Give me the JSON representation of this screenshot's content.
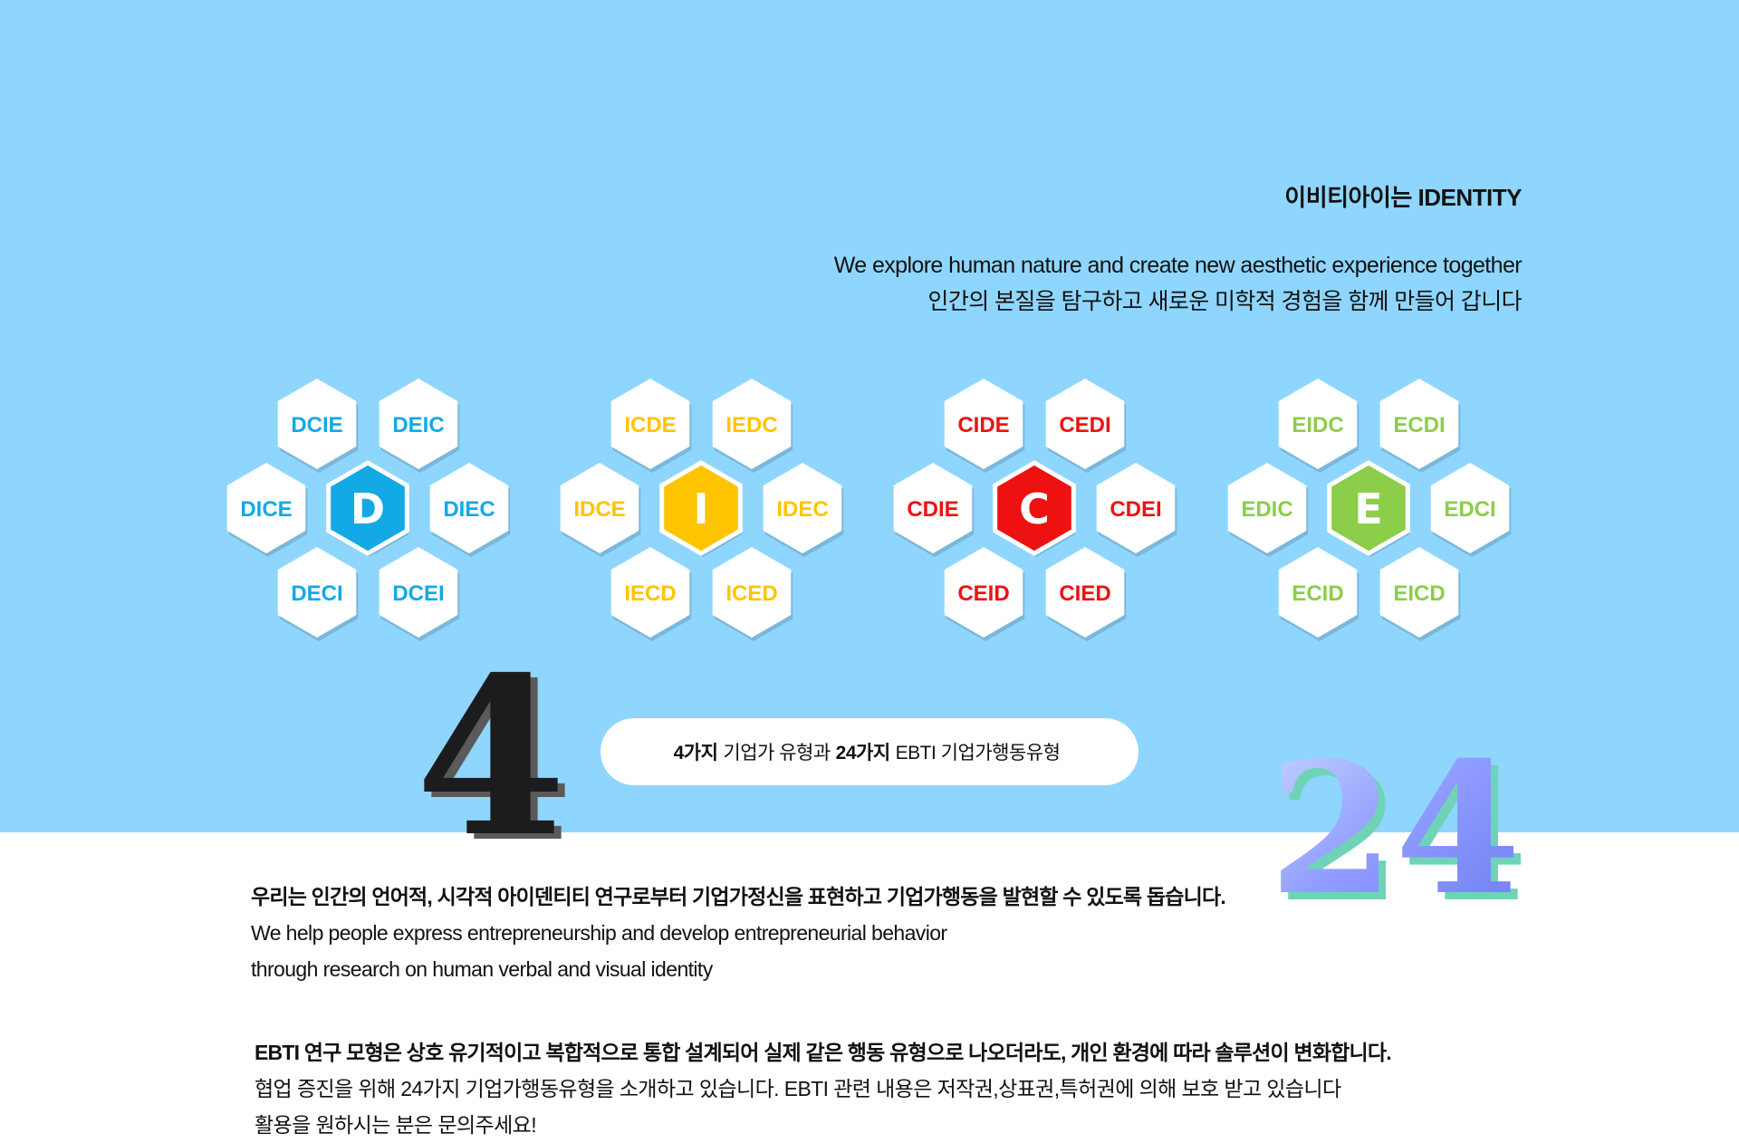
{
  "colors": {
    "background": "#8fd6ff",
    "D": "#12a9e6",
    "I": "#ffc400",
    "C": "#ee1111",
    "E": "#8ccd4a",
    "number_24": "#8f9bff"
  },
  "intro": {
    "title": "이비티아이는 IDENTITY",
    "line_en": "We explore human nature and create new aesthetic experience together",
    "line_ko": "인간의 본질을 탐구하고 새로운 미학적 경험을 함께 만들어 갑니다"
  },
  "flowers": [
    {
      "center": "D",
      "color": "#12a9e6",
      "petals": [
        "DCIE",
        "DEIC",
        "DICE",
        "DIEC",
        "DECI",
        "DCEI"
      ]
    },
    {
      "center": "I",
      "color": "#ffc400",
      "petals": [
        "ICDE",
        "IEDC",
        "IDCE",
        "IDEC",
        "IECD",
        "ICED"
      ]
    },
    {
      "center": "C",
      "color": "#ee1111",
      "petals": [
        "CIDE",
        "CEDI",
        "CDIE",
        "CDEI",
        "CEID",
        "CIED"
      ]
    },
    {
      "center": "E",
      "color": "#8ccd4a",
      "petals": [
        "EIDC",
        "ECDI",
        "EDIC",
        "EDCI",
        "ECID",
        "EICD"
      ]
    }
  ],
  "numbers": {
    "four": "4",
    "twenty_four": "24"
  },
  "pill": {
    "part1_bold": "4가지",
    "part2": "기업가 유형과",
    "part3_bold": "24가지",
    "part4": "EBTI 기업가행동유형"
  },
  "section1": {
    "lead": "우리는 인간의 언어적, 시각적 아이덴티티 연구로부터 기업가정신을 표현하고 기업가행동을 발현할 수 있도록 돕습니다.",
    "line1": "We help people express entrepreneurship and develop entrepreneurial behavior",
    "line2": "through research on human verbal and visual identity"
  },
  "section2": {
    "lead": "EBTI 연구 모형은 상호 유기적이고 복합적으로 통합 설계되어 실제 같은 행동 유형으로 나오더라도, 개인 환경에 따라 솔루션이 변화합니다.",
    "line1": "협업 증진을 위해 24가지 기업가행동유형을 소개하고 있습니다. EBTI 관련 내용은 저작권,상표권,특허권에 의해 보호 받고 있습니다",
    "line2": "활용을 원하시는 분은 문의주세요!"
  }
}
